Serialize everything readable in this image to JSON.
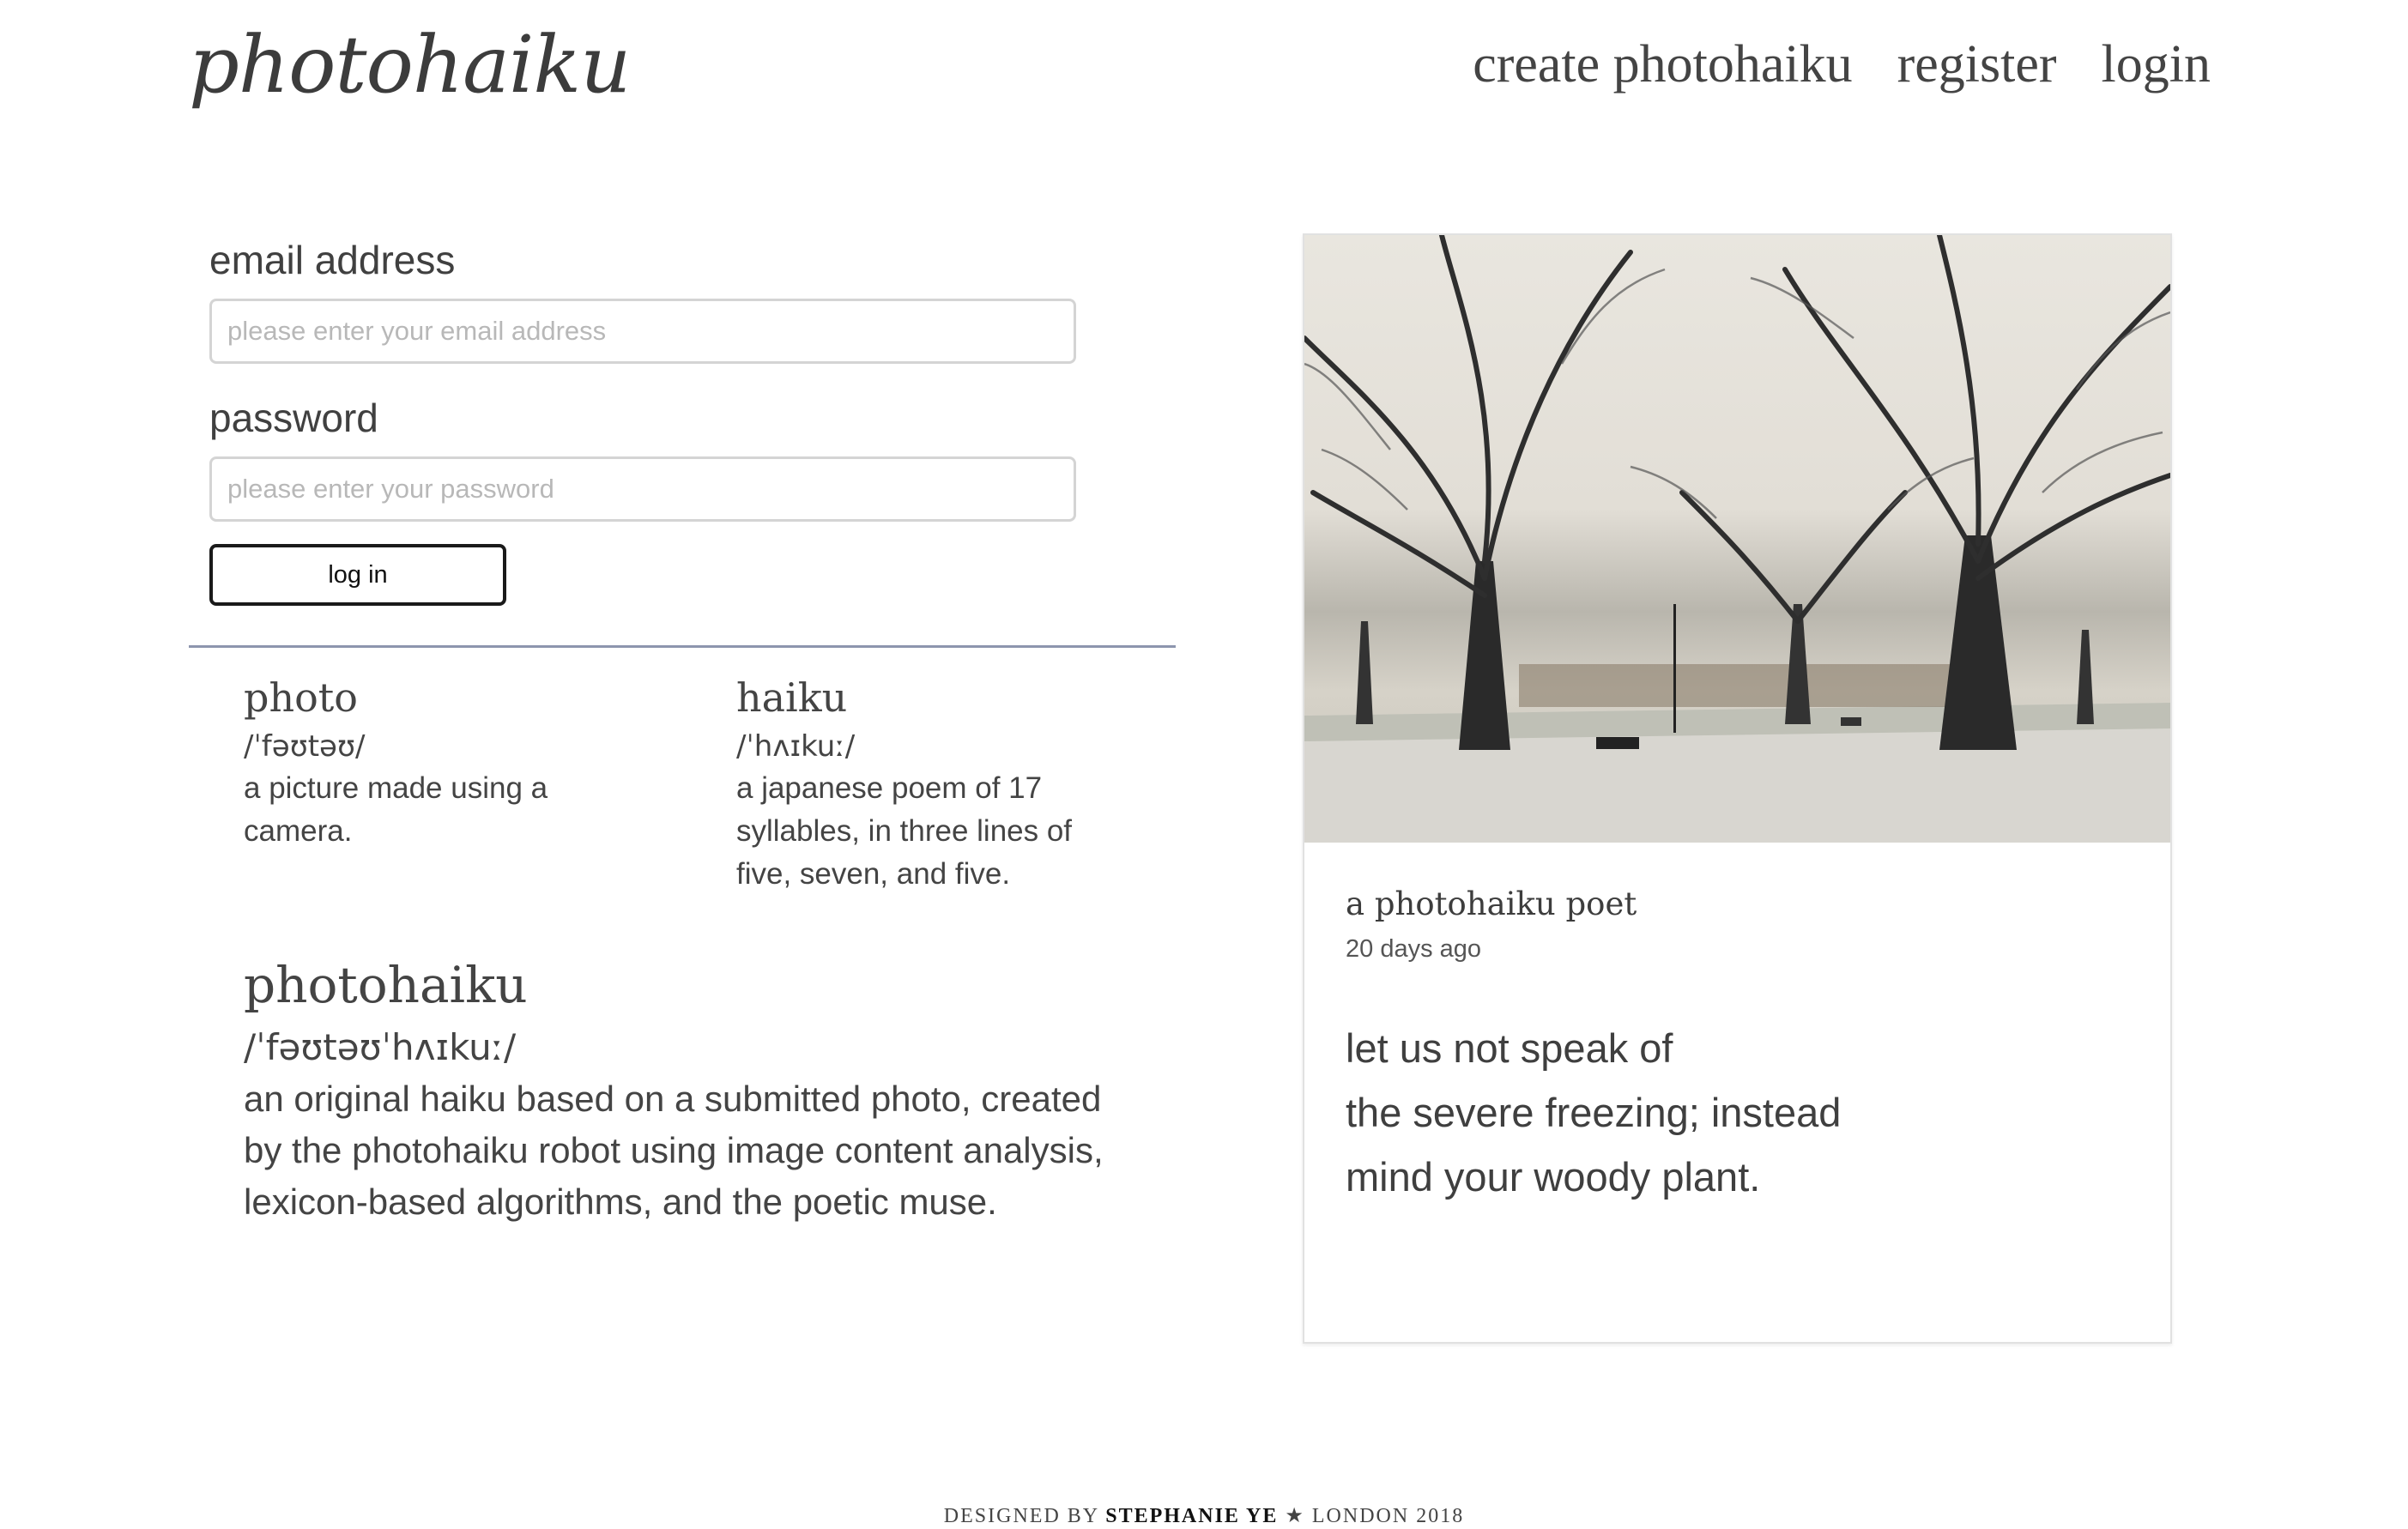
{
  "brand": {
    "logo": "photohaiku"
  },
  "nav": {
    "items": [
      "create photohaiku",
      "register",
      "login"
    ]
  },
  "login_form": {
    "email_label": "email address",
    "email_placeholder": "please enter your email address",
    "password_label": "password",
    "password_placeholder": "please enter your password",
    "submit_label": "log in"
  },
  "definitions": {
    "photo": {
      "term": "photo",
      "pronunciation": "/ˈfəʊtəʊ/",
      "meaning": "a picture made using a camera."
    },
    "haiku": {
      "term": "haiku",
      "pronunciation": "/ˈhʌɪkuː/",
      "meaning": "a japanese poem of 17 syllables, in three lines of five, seven, and five."
    },
    "photohaiku": {
      "term": "photohaiku",
      "pronunciation": "/ˈfəʊtəʊˈhʌɪkuː/",
      "meaning": "an original haiku based on a submitted photo, created by the photohaiku robot using image content analysis, lexicon-based algorithms, and the poetic muse."
    }
  },
  "card": {
    "author": "a photohaiku poet",
    "time": "20 days ago",
    "poem": [
      "let us not speak of",
      "the severe freezing; instead",
      "mind your woody plant."
    ]
  },
  "footer": {
    "prefix": "DESIGNED BY ",
    "name": "STEPHANIE YE",
    "suffix": " ★ LONDON 2018"
  },
  "colors": {
    "accent_divider": "#8d95ae",
    "text": "#3f3f3f",
    "button_border": "#1a1a1a"
  }
}
